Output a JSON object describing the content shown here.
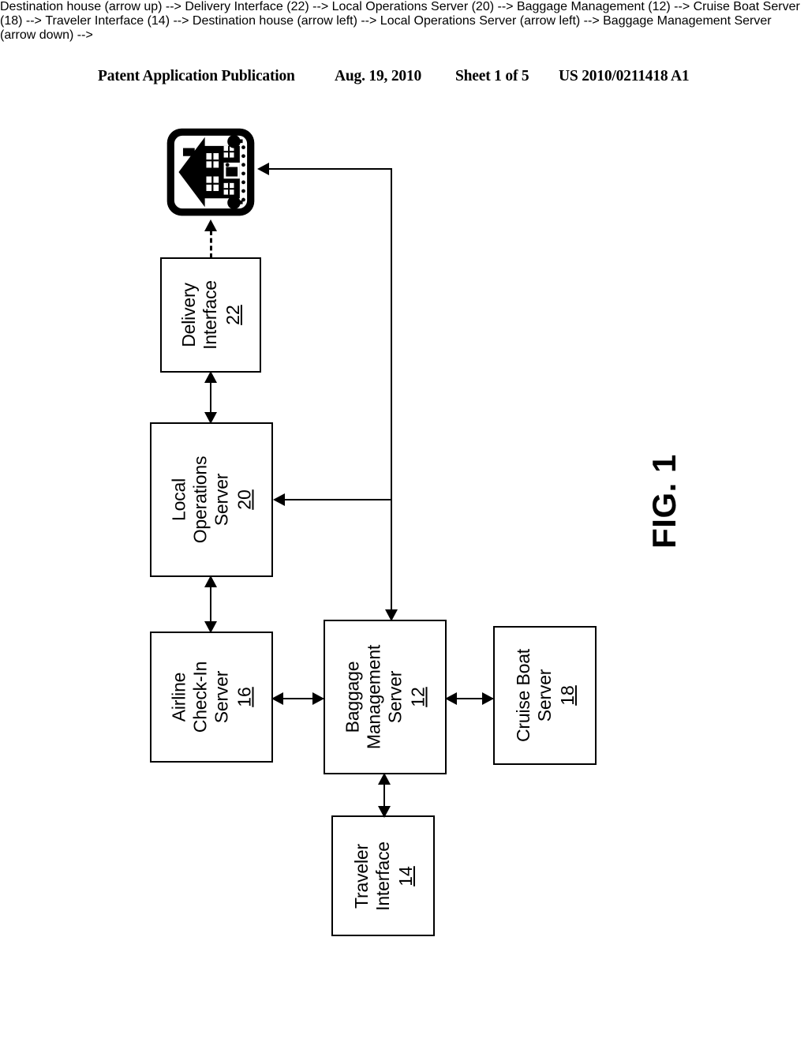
{
  "header": {
    "publication": "Patent Application Publication",
    "date": "Aug. 19, 2010",
    "sheet": "Sheet 1 of 5",
    "patent_number": "US 2010/0211418 A1"
  },
  "figure": {
    "label": "FIG. 1",
    "orientation": "landscape-rotated-90ccw"
  },
  "diagram": {
    "nodes": [
      {
        "id": "destination",
        "type": "icon",
        "icon": "house-building-icon",
        "label": "",
        "ref": ""
      },
      {
        "id": "delivery-interface",
        "type": "box",
        "label": "Delivery\nInterface",
        "line1": "Delivery",
        "line2": "Interface",
        "ref": "22"
      },
      {
        "id": "local-operations-server",
        "type": "box",
        "label": "Local\nOperations\nServer",
        "line1": "Local",
        "line2": "Operations",
        "line3": "Server",
        "ref": "20"
      },
      {
        "id": "airline-checkin-server",
        "type": "box",
        "label": "Airline\nCheck-In\nServer",
        "line1": "Airline",
        "line2": "Check-In",
        "line3": "Server",
        "ref": "16"
      },
      {
        "id": "baggage-management-server",
        "type": "box",
        "label": "Baggage\nManagement\nServer",
        "line1": "Baggage",
        "line2": "Management",
        "line3": "Server",
        "ref": "12"
      },
      {
        "id": "cruise-boat-server",
        "type": "box",
        "label": "Cruise Boat\nServer",
        "line1": "Cruise Boat",
        "line2": "Server",
        "ref": "18"
      },
      {
        "id": "traveler-interface",
        "type": "box",
        "label": "Traveler\nInterface",
        "line1": "Traveler",
        "line2": "Interface",
        "ref": "14"
      }
    ],
    "connectors": [
      {
        "id": "delivery-to-destination",
        "from": "delivery-interface",
        "to": "destination",
        "style": "dashed",
        "direction": "one-way"
      },
      {
        "id": "localops-to-delivery",
        "from": "local-operations-server",
        "to": "delivery-interface",
        "style": "solid",
        "direction": "bidirectional"
      },
      {
        "id": "airline-to-localops",
        "from": "airline-checkin-server",
        "to": "local-operations-server",
        "style": "solid",
        "direction": "bidirectional"
      },
      {
        "id": "airline-to-baggage",
        "from": "airline-checkin-server",
        "to": "baggage-management-server",
        "style": "solid",
        "direction": "bidirectional"
      },
      {
        "id": "baggage-to-cruise",
        "from": "baggage-management-server",
        "to": "cruise-boat-server",
        "style": "solid",
        "direction": "bidirectional"
      },
      {
        "id": "baggage-to-traveler",
        "from": "baggage-management-server",
        "to": "traveler-interface",
        "style": "solid",
        "direction": "bidirectional"
      },
      {
        "id": "bus-to-destination",
        "from": "bus",
        "to": "destination",
        "style": "solid",
        "direction": "one-way"
      },
      {
        "id": "bus-to-localops",
        "from": "bus",
        "to": "local-operations-server",
        "style": "solid",
        "direction": "one-way"
      },
      {
        "id": "bus-to-baggage",
        "from": "bus",
        "to": "baggage-management-server",
        "style": "solid",
        "direction": "one-way"
      }
    ]
  },
  "colors": {
    "ink": "#000000",
    "paper": "#ffffff"
  }
}
